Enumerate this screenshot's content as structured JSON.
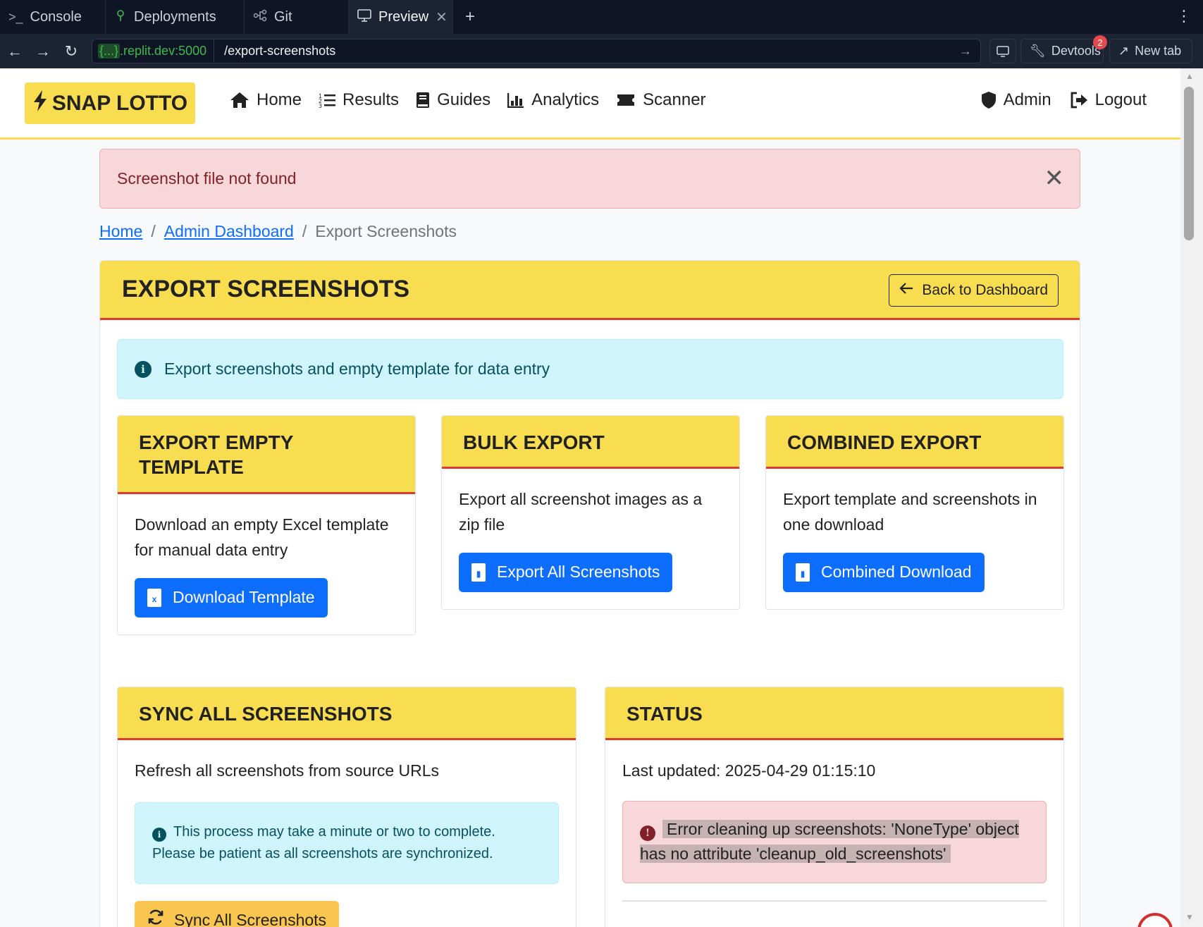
{
  "browser": {
    "tabs": [
      {
        "label": "Console",
        "icon": "terminal-icon"
      },
      {
        "label": "Deployments",
        "icon": "deployments-icon"
      },
      {
        "label": "Git",
        "icon": "git-icon"
      },
      {
        "label": "Preview",
        "icon": "monitor-icon",
        "active": true
      }
    ],
    "url_host_prefix": "{...}",
    "url_host": ".replit.dev:5000",
    "url_path": "/export-screenshots",
    "devtools_label": "Devtools",
    "devtools_badge": "2",
    "newtab_label": "New tab"
  },
  "navbar": {
    "brand": "SNAP LOTTO",
    "links": [
      {
        "label": "Home",
        "icon": "home-icon"
      },
      {
        "label": "Results",
        "icon": "list-icon"
      },
      {
        "label": "Guides",
        "icon": "book-icon"
      },
      {
        "label": "Analytics",
        "icon": "chart-icon"
      },
      {
        "label": "Scanner",
        "icon": "ticket-icon"
      }
    ],
    "right": [
      {
        "label": "Admin",
        "icon": "shield-icon"
      },
      {
        "label": "Logout",
        "icon": "logout-icon"
      }
    ]
  },
  "alert": {
    "message": "Screenshot file not found"
  },
  "breadcrumb": {
    "home": "Home",
    "admin": "Admin Dashboard",
    "current": "Export Screenshots"
  },
  "page": {
    "title": "EXPORT SCREENSHOTS",
    "back_label": "Back to Dashboard",
    "info": "Export screenshots and empty template for data entry"
  },
  "cards": {
    "template": {
      "title": "EXPORT EMPTY TEMPLATE",
      "text": "Download an empty Excel template for manual data entry",
      "button": "Download Template"
    },
    "bulk": {
      "title": "BULK EXPORT",
      "text": "Export all screenshot images as a zip file",
      "button": "Export All Screenshots"
    },
    "combined": {
      "title": "COMBINED EXPORT",
      "text": "Export template and screenshots in one download",
      "button": "Combined Download"
    },
    "sync": {
      "title": "SYNC ALL SCREENSHOTS",
      "text": "Refresh all screenshots from source URLs",
      "info": "This process may take a minute or two to complete. Please be patient as all screenshots are synchronized.",
      "button": "Sync All Screenshots"
    },
    "status": {
      "title": "STATUS",
      "last_updated": "Last updated: 2025-04-29 01:15:10",
      "error": "Error cleaning up screenshots: 'NoneType' object has no attribute 'cleanup_old_screenshots'"
    }
  },
  "colors": {
    "brand_yellow": "#f9dd50",
    "accent_red": "#dc3b2d",
    "primary_blue": "#0d6efd",
    "warning_yellow": "#f9c74f"
  }
}
